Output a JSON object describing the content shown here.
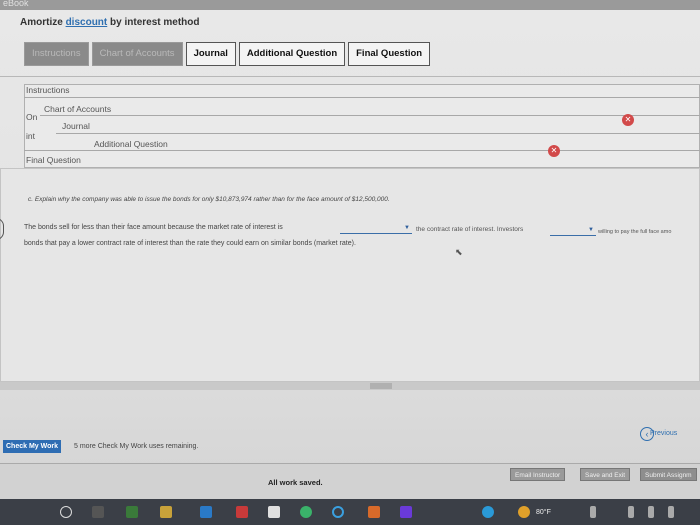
{
  "topstrip": {
    "label": "eBook"
  },
  "title": {
    "prefix": "Amortize",
    "link": "discount",
    "suffix": "by interest method"
  },
  "tabs": [
    {
      "label": "Instructions",
      "state": "dim"
    },
    {
      "label": "Chart of Accounts",
      "state": "dim"
    },
    {
      "label": "Journal",
      "state": "active"
    },
    {
      "label": "Additional Question",
      "state": "active"
    },
    {
      "label": "Final Question",
      "state": "active"
    }
  ],
  "stack": {
    "instructions": "Instructions",
    "chart": "Chart of Accounts",
    "journal": "Journal",
    "additional": "Additional Question",
    "final": "Final Question",
    "on_fragment": "On",
    "int_fragment": "int"
  },
  "question": {
    "text": "c. Explain why the company was able to issue the bonds for only $10,873,974 rather than for the face amount of $12,500,000."
  },
  "answer": {
    "line1_part1": "The bonds sell for less than their face amount because the market rate of interest is",
    "line1_part2": "the contract rate of interest. Investors",
    "line1_part3": "willing to pay the full face amo",
    "line2": "bonds that pay a lower contract rate of interest than the rate they could earn on similar bonds (market rate)."
  },
  "footer": {
    "check_work": "Check My Work",
    "remaining": "5 more Check My Work uses remaining.",
    "previous": "Previous",
    "saved": "All work saved.",
    "email": "Email Instructor",
    "save_exit": "Save and Exit",
    "submit": "Submit Assignm"
  },
  "taskbar": {
    "temperature": "80°F"
  },
  "colors": {
    "accent": "#2e6db3",
    "close": "#d24a4a",
    "taskbar": "#3b3f47"
  }
}
